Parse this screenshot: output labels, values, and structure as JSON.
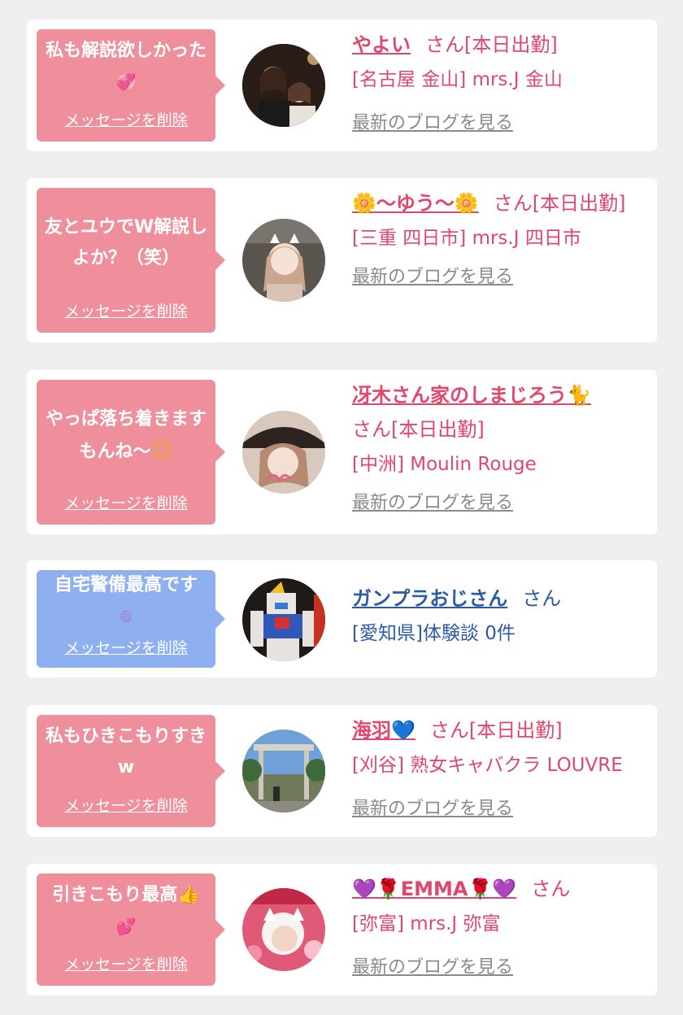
{
  "common": {
    "delete_label": "メッセージを削除",
    "blog_label": "最新のブログを見る"
  },
  "items": [
    {
      "message": "私も解説欲しかった",
      "message_emoji": "💞",
      "name": "やよい",
      "suffix": "さん[本日出勤]",
      "location": "[名古屋 金山] mrs.J 金山",
      "blog": "最新のブログを見る"
    },
    {
      "message": "友とユウでW解説しよか？（笑）",
      "message_emoji": "",
      "name": "🌼〜ゆう〜🌼",
      "suffix": "さん[本日出勤]",
      "location": "[三重 四日市] mrs.J 四日市",
      "blog": "最新のブログを見る"
    },
    {
      "message": "やっぱ落ち着きますもんね〜",
      "message_emoji": "☺",
      "name": "冴木さん家のしまじろう🐈",
      "suffix": "さん[本日出勤]",
      "location": "[中洲] Moulin Rouge",
      "blog": "最新のブログを見る"
    },
    {
      "message": "自宅警備最高です",
      "message_emoji": "😄",
      "name": "ガンプラおじさん",
      "suffix": "さん",
      "location": "[愛知県]体験談 0件",
      "blog": ""
    },
    {
      "message": "私もひきこもりすきw",
      "message_emoji": "",
      "name": "海羽💙",
      "suffix": "さん[本日出勤]",
      "location": "[刈谷] 熟女キャバクラ LOUVRE",
      "blog": "最新のブログを見る"
    },
    {
      "message": "引きこもり最高👍",
      "message_emoji": "💕",
      "name": "💜🌹EMMA🌹💜",
      "suffix": "さん",
      "location": "[弥富] mrs.J 弥富",
      "blog": "最新のブログを見る"
    }
  ]
}
